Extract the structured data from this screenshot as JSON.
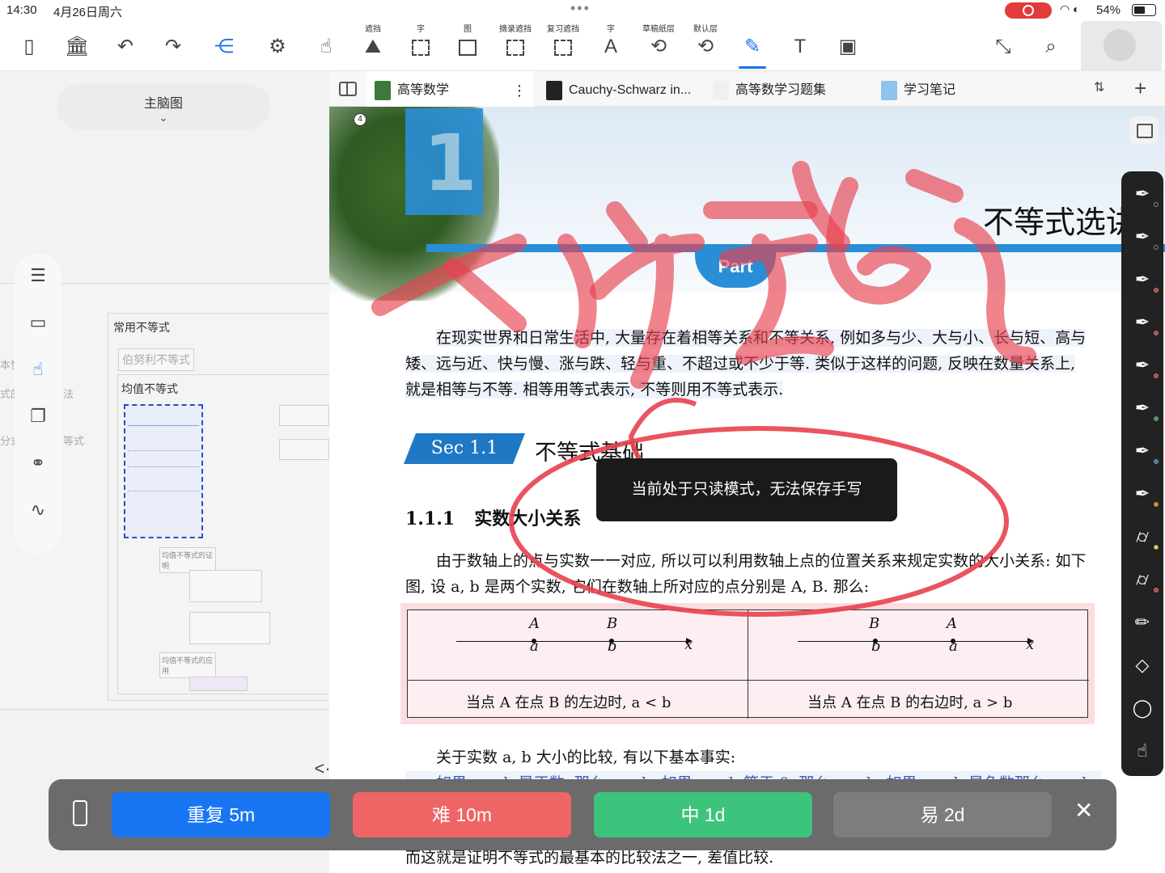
{
  "status": {
    "time": "14:30",
    "date": "4月26日周六",
    "battery": "54%",
    "battery_level": 0.54
  },
  "toolbar": {
    "tools": [
      {
        "name": "sidebar-icon",
        "caption": "",
        "glyph": "▯"
      },
      {
        "name": "library-icon",
        "caption": "",
        "glyph": "🏛"
      },
      {
        "name": "undo-icon",
        "caption": "",
        "glyph": "↶"
      },
      {
        "name": "redo-icon",
        "caption": "",
        "glyph": "↷"
      },
      {
        "name": "mindmap-icon",
        "caption": "",
        "glyph": "⋲"
      },
      {
        "name": "settings-gear-icon",
        "caption": "",
        "glyph": "⚙"
      },
      {
        "name": "hand-pointer-icon",
        "caption": "",
        "glyph": "☝"
      },
      {
        "name": "mask-icon",
        "caption": "遮挡",
        "glyph": "⛰"
      },
      {
        "name": "text-box-icon",
        "caption": "字",
        "glyph": ""
      },
      {
        "name": "image-box-icon",
        "caption": "图",
        "glyph": ""
      },
      {
        "name": "excerpt-mask-icon",
        "caption": "摘录遮挡",
        "glyph": ""
      },
      {
        "name": "review-mask-icon",
        "caption": "复习遮挡",
        "glyph": ""
      },
      {
        "name": "text-underline-icon",
        "caption": "字",
        "glyph": "A"
      },
      {
        "name": "draft-layer-icon",
        "caption": "草稿纸层",
        "glyph": "⟲"
      },
      {
        "name": "default-layer-icon",
        "caption": "默认层",
        "glyph": "⟲"
      },
      {
        "name": "pen-icon",
        "caption": "",
        "glyph": "✎"
      },
      {
        "name": "text-frame-icon",
        "caption": "",
        "glyph": "T"
      },
      {
        "name": "image-insert-icon",
        "caption": "",
        "glyph": "▣"
      },
      {
        "name": "collapse-icon",
        "caption": "",
        "glyph": "⤡"
      },
      {
        "name": "search-doc-icon",
        "caption": "",
        "glyph": "⌕"
      },
      {
        "name": "notebook-icon",
        "caption": "",
        "glyph": "▤"
      },
      {
        "name": "more-vertical-icon",
        "caption": "",
        "glyph": "⋮"
      }
    ]
  },
  "left": {
    "mindmap_label": "主脑图",
    "mindmap_chevron": "⌄",
    "side_icons": [
      "list-icon",
      "card-view-icon",
      "hand-icon",
      "copy-icon",
      "link-icon",
      "handwriting-icon"
    ],
    "nodes": {
      "common": "常用不等式",
      "bernoulli": "伯努利不等式",
      "mean": "均值不等式",
      "proof": "均值不等式的证明",
      "apply": "均值不等式的应用",
      "side1": "式的",
      "side2": "本性",
      "side3": "法",
      "side4": "分式",
      "side5": "等式"
    },
    "nav_arrows": "<·>"
  },
  "tabs": [
    {
      "label": "高等数学",
      "color": "#3b7a3b",
      "active": true
    },
    {
      "label": "Cauchy-Schwarz in...",
      "color": "#222",
      "active": false
    },
    {
      "label": "高等数学习题集",
      "color": "#f0f0f0",
      "active": false
    },
    {
      "label": "学习笔记",
      "color": "#8fc3ee",
      "active": false
    }
  ],
  "tab_more": "⋮",
  "tab_plus": "+",
  "tab_sort": "⇅",
  "doc": {
    "badge": "4",
    "chapter_num": "1",
    "part": "Part",
    "title": "不等式选讲",
    "intro": "在现实世界和日常生活中, 大量存在着相等关系和不等关系, 例如多与少、大与小、长与短、高与矮、远与近、快与慢、涨与跌、轻与重、不超过或不少于等. 类似于这样的问题, 反映在数量关系上, 就是相等与不等. 相等用等式表示, 不等则用不等式表示.",
    "sec_tag": "Sec 1.1",
    "sec_title": "不等式基础",
    "sub_num": "1.1.1",
    "sub_title": "实数大小关系",
    "para2": "由于数轴上的点与实数一一对应, 所以可以利用数轴上点的位置关系来规定实数的大小关系: 如下图, 设 a, b 是两个实数, 它们在数轴上所对应的点分别是 A, B. 那么:",
    "cell1": {
      "top1": "A",
      "top2": "B",
      "bot1": "a",
      "bot2": "b",
      "axis": "x",
      "caption": "当点 A 在点 B 的左边时, a < b"
    },
    "cell2": {
      "top1": "B",
      "top2": "A",
      "bot1": "b",
      "bot2": "a",
      "axis": "x",
      "caption": "当点 A 在点 B 的右边时, a > b"
    },
    "fact": "关于实数 a, b 大小的比较, 有以下基本事实:",
    "fact2": "如果 a − b 是正数, 那么 a > b; 如果 a − b 等于 0, 那么 a = b; 如果 a − b 是负数那么 a < b.",
    "fact3": "而这就是证明不等式的最基本的比较法之一, 差值比较."
  },
  "toast": "当前处于只读模式，无法保存手写",
  "pens": [
    {
      "name": "pen-tool-1-icon",
      "dot": "#222"
    },
    {
      "name": "pen-tool-2-icon",
      "dot": "#222"
    },
    {
      "name": "pen-tool-3-icon",
      "dot": "#e53935"
    },
    {
      "name": "pen-tool-4-icon",
      "dot": "#e53935"
    },
    {
      "name": "pen-tool-5-icon",
      "dot": "#e53935"
    },
    {
      "name": "pen-tool-6-icon",
      "dot": "#43a047"
    },
    {
      "name": "pen-tool-7-icon",
      "dot": "#1e88e5"
    },
    {
      "name": "pen-tool-8-icon",
      "dot": "#fb8c00"
    },
    {
      "name": "highlighter-1-icon",
      "dot": "#fdd835"
    },
    {
      "name": "highlighter-2-icon",
      "dot": "#e53935"
    },
    {
      "name": "pencil-icon",
      "dot": ""
    },
    {
      "name": "eraser-icon",
      "dot": ""
    },
    {
      "name": "lasso-icon",
      "dot": ""
    },
    {
      "name": "touch-gesture-icon",
      "dot": ""
    }
  ],
  "review": {
    "again": "重复 5m",
    "again_color": "#1976f2",
    "hard": "难 10m",
    "hard_color": "#ef6464",
    "good": "中 1d",
    "good_color": "#3cc47c",
    "easy": "易 2d",
    "easy_color": "#7d7d7d",
    "close": "✕"
  }
}
